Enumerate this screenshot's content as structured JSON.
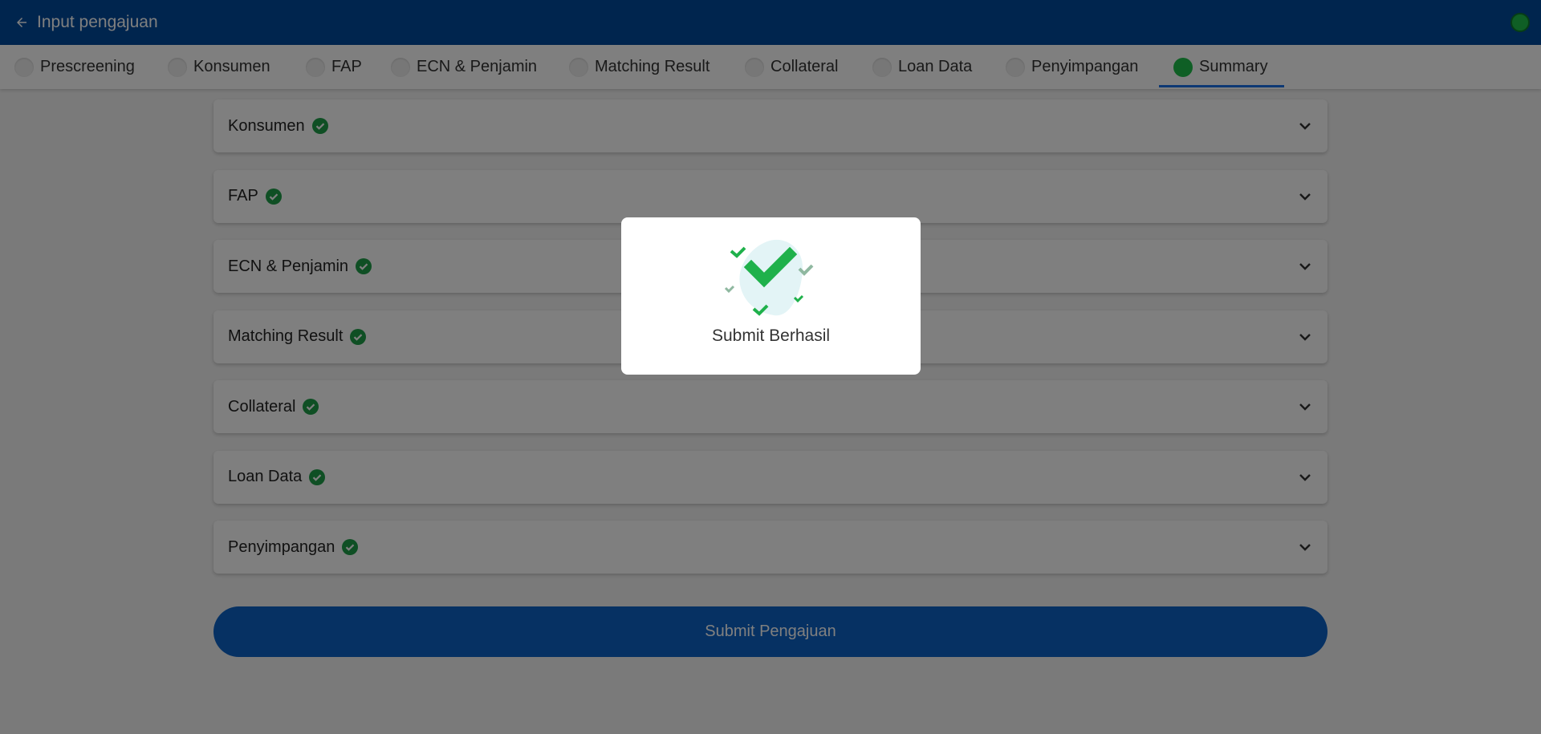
{
  "header": {
    "title": "Input pengajuan"
  },
  "tabs": [
    {
      "label": "Prescreening",
      "active": false
    },
    {
      "label": "Konsumen",
      "active": false
    },
    {
      "label": "FAP",
      "active": false
    },
    {
      "label": "ECN & Penjamin",
      "active": false
    },
    {
      "label": "Matching Result",
      "active": false
    },
    {
      "label": "Collateral",
      "active": false
    },
    {
      "label": "Loan Data",
      "active": false
    },
    {
      "label": "Penyimpangan",
      "active": false
    },
    {
      "label": "Summary",
      "active": true
    }
  ],
  "sections": [
    {
      "label": "Konsumen"
    },
    {
      "label": "FAP"
    },
    {
      "label": "ECN & Penjamin"
    },
    {
      "label": "Matching Result"
    },
    {
      "label": "Collateral"
    },
    {
      "label": "Loan Data"
    },
    {
      "label": "Penyimpangan"
    }
  ],
  "submit_label": "Submit Pengajuan",
  "modal": {
    "message": "Submit Berhasil"
  },
  "colors": {
    "brand": "#004a9c",
    "success": "#1fbf4a",
    "button": "#0d62c6",
    "tab_underline": "#1a73e8"
  }
}
